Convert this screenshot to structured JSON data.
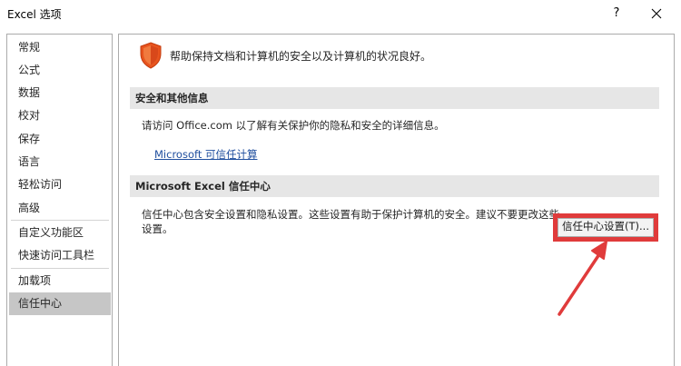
{
  "window": {
    "title": "Excel 选项",
    "help_label": "?"
  },
  "sidebar": {
    "items": [
      {
        "label": "常规"
      },
      {
        "label": "公式"
      },
      {
        "label": "数据"
      },
      {
        "label": "校对"
      },
      {
        "label": "保存"
      },
      {
        "label": "语言"
      },
      {
        "label": "轻松访问"
      },
      {
        "label": "高级"
      },
      {
        "label": "自定义功能区"
      },
      {
        "label": "快速访问工具栏"
      },
      {
        "label": "加载项"
      },
      {
        "label": "信任中心",
        "selected": true
      }
    ]
  },
  "main": {
    "intro_text": "帮助保持文档和计算机的安全以及计算机的状况良好。",
    "privacy_section": {
      "header": "安全和其他信息",
      "text": "请访问 Office.com 以了解有关保护你的隐私和安全的详细信息。",
      "link_label": "Microsoft 可信任计算"
    },
    "trust_center_section": {
      "header": "Microsoft Excel 信任中心",
      "text_line1": "信任中心包含安全设置和隐私设置。这些设置有助于保护计算机的安全。建议不要更改这些",
      "text_line2": "设置。",
      "button_label": "信任中心设置(T)..."
    }
  },
  "colors": {
    "annotation_red": "#e03b3b",
    "shield_orange": "#e8541e",
    "link_blue": "#1f4e9e",
    "selected_bg": "#c6c6c6"
  },
  "icons": {
    "shield": "shield-icon",
    "close": "close-icon",
    "annotation": "annotation-arrow"
  }
}
